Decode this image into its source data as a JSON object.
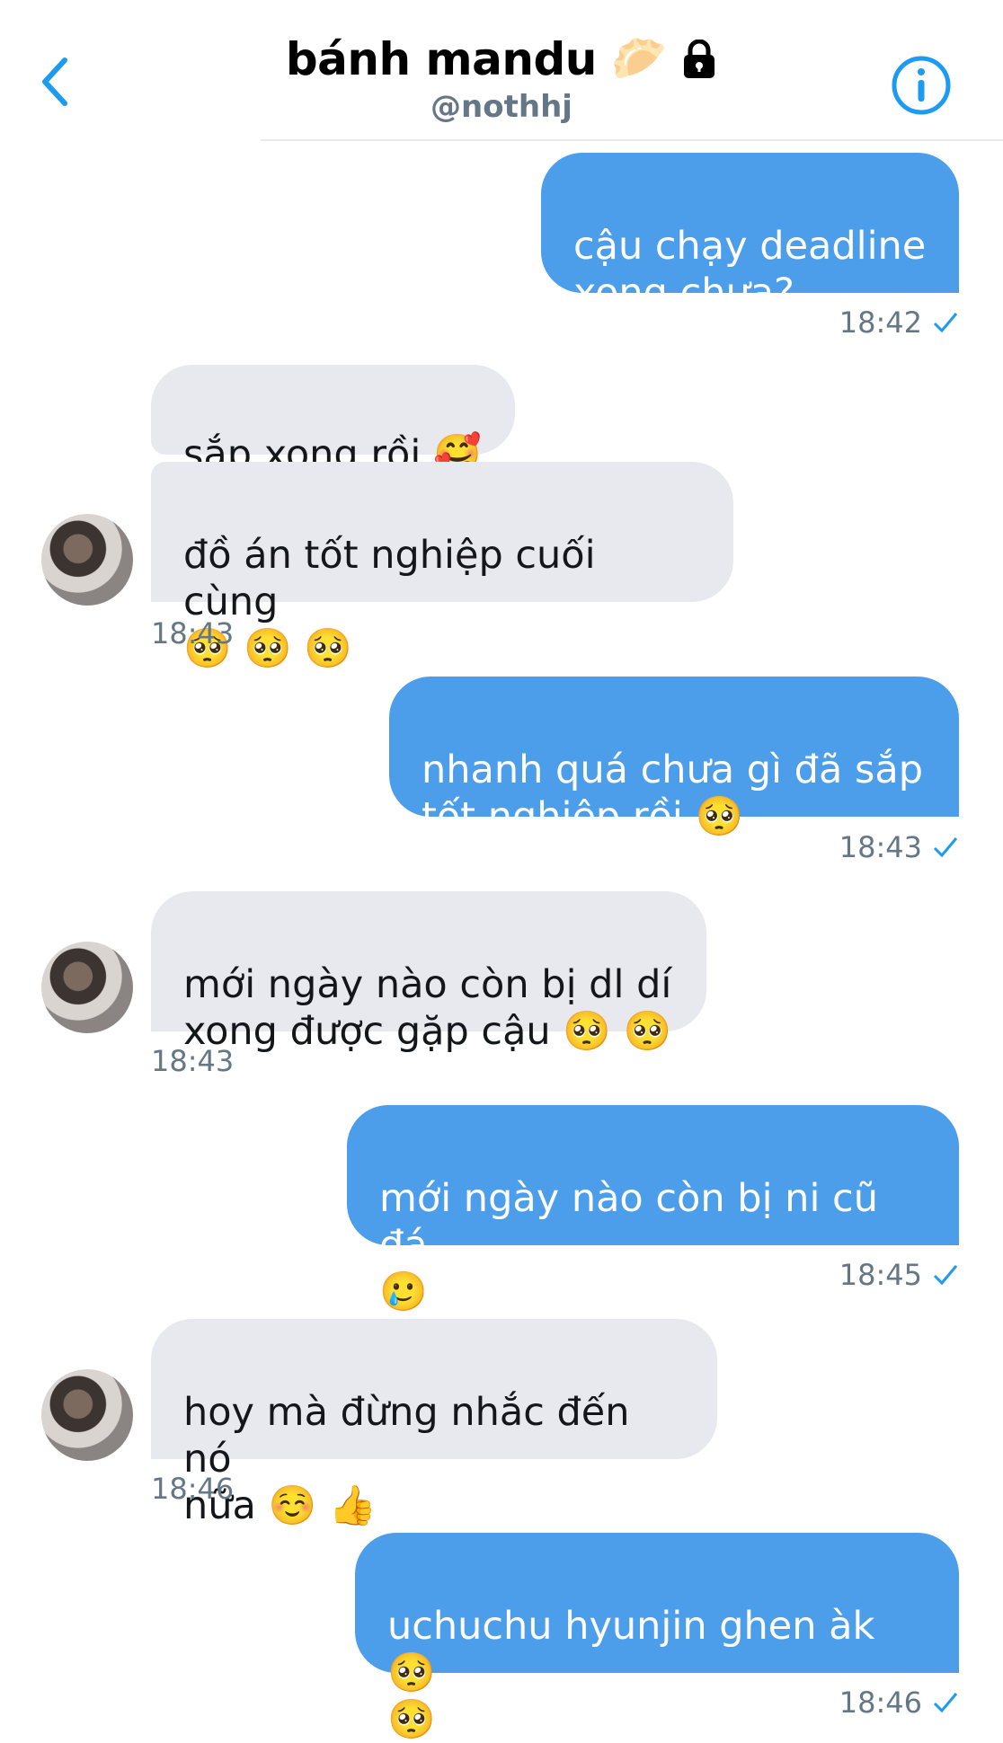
{
  "header": {
    "title": "bánh mandu",
    "title_emoji": "🥟",
    "handle": "@nothhj",
    "back_icon": "chevron-left-icon",
    "lock_icon": "lock-icon",
    "info_icon": "info-icon"
  },
  "colors": {
    "accent": "#1d9bf0",
    "outgoing_bubble": "#4c9eea",
    "incoming_bubble": "#e7e9ee",
    "timestamp": "#657786"
  },
  "messages": [
    {
      "direction": "out",
      "text": "cậu chạy deadline\nxong chưa?",
      "time": "18:42"
    },
    {
      "direction": "in",
      "text": "sắp xong rồi 🥰"
    },
    {
      "direction": "in",
      "text": "đồ án tốt nghiệp cuối cùng\n🥺 🥺 🥺",
      "time": "18:43"
    },
    {
      "direction": "out",
      "text": " nhanh quá chưa gì đã sắp\ntốt nghiệp rồi 🥺",
      "time": "18:43"
    },
    {
      "direction": "in",
      "text": " mới ngày nào còn bị dl dí\nxong được gặp cậu 🥺 🥺",
      "time": "18:43"
    },
    {
      "direction": "out",
      "text": "mới ngày nào còn bị ni cũ đá\n🥲",
      "time": "18:45"
    },
    {
      "direction": "in",
      "text": "hoy mà đừng nhắc đến nó\nnữa ☺️ 👍",
      "time": "18:46"
    },
    {
      "direction": "out",
      "text": "uchuchu hyunjin ghen àk 🥺\n🥺",
      "time": "18:46"
    }
  ]
}
